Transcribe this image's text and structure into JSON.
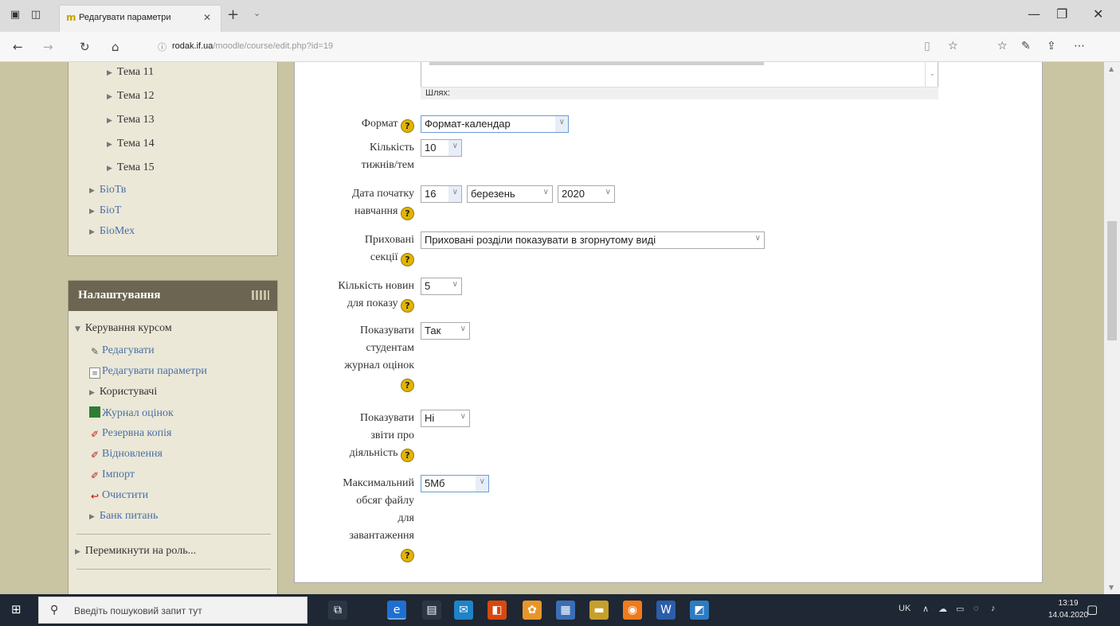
{
  "browser": {
    "tab_title": "Редагувати параметри",
    "url_host": "rodak.if.ua",
    "url_path": "/moodle/course/edit.php?id=19"
  },
  "nav_block": {
    "items": [
      {
        "label": "Тема 11",
        "link": false
      },
      {
        "label": "Тема 12",
        "link": false
      },
      {
        "label": "Тема 13",
        "link": false
      },
      {
        "label": "Тема 14",
        "link": false
      },
      {
        "label": "Тема 15",
        "link": false
      },
      {
        "label": "БіоТв",
        "link": true
      },
      {
        "label": "БіоТ",
        "link": true
      },
      {
        "label": "БіоМех",
        "link": true
      }
    ]
  },
  "settings_block": {
    "title": "Налаштування",
    "course_admin": "Керування курсом",
    "items": [
      {
        "label": "Редагувати",
        "icon": "pencil-icon"
      },
      {
        "label": "Редагувати параметри",
        "icon": "document-icon"
      },
      {
        "label": "Користувачі",
        "icon": "arrow-icon"
      },
      {
        "label": "Журнал оцінок",
        "icon": "grades-icon"
      },
      {
        "label": "Резервна копія",
        "icon": "backup-icon"
      },
      {
        "label": "Відновлення",
        "icon": "restore-icon"
      },
      {
        "label": "Імпорт",
        "icon": "import-icon"
      },
      {
        "label": "Очистити",
        "icon": "reset-icon"
      },
      {
        "label": "Банк питань",
        "icon": "arrow-icon"
      }
    ],
    "switch_role": "Перемикнути на роль..."
  },
  "form": {
    "path_label": "Шлях:",
    "format_label": "Формат",
    "format_value": "Формат-календар",
    "num_sections_label_1": "Кількість",
    "num_sections_label_2": "тижнів/тем",
    "num_sections_value": "10",
    "start_date_label_1": "Дата початку",
    "start_date_label_2": "навчання",
    "start_day": "16",
    "start_month": "березень",
    "start_year": "2020",
    "hidden_label_1": "Приховані",
    "hidden_label_2": "секції",
    "hidden_value": "Приховані розділи показувати в згорнутому виді",
    "news_label_1": "Кількість новин",
    "news_label_2": "для показу",
    "news_value": "5",
    "grades_label_1": "Показувати",
    "grades_label_2": "студентам",
    "grades_label_3": "журнал оцінок",
    "grades_value": "Так",
    "reports_label_1": "Показувати",
    "reports_label_2": "звіти про",
    "reports_label_3": "діяльність",
    "reports_value": "Ні",
    "maxsize_label_1": "Максимальний",
    "maxsize_label_2": "обсяг файлу",
    "maxsize_label_3": "для",
    "maxsize_label_4": "завантаження",
    "maxsize_value": "5Мб",
    "help_glyph": "?"
  },
  "taskbar": {
    "search_placeholder": "Введіть пошуковий запит тут",
    "lang": "UK",
    "time": "13:19",
    "date": "14.04.2020"
  }
}
